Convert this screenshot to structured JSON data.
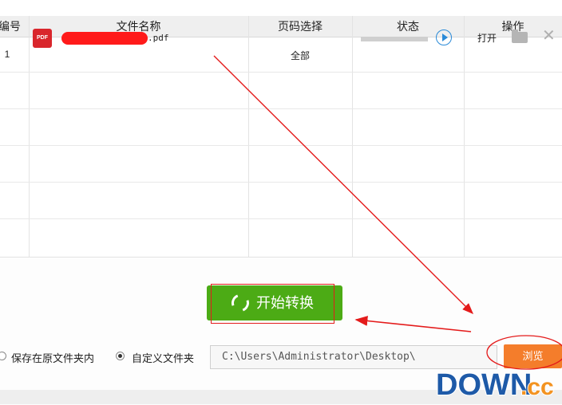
{
  "table": {
    "headers": [
      "编号",
      "文件名称",
      "页码选择",
      "状态",
      "操作"
    ],
    "rows": [
      {
        "index": "1",
        "file_icon_label": "PDF",
        "file_name_suffix": ".pdf",
        "page_selection": "全部",
        "progress": 0,
        "open_label": "打开"
      }
    ]
  },
  "icons": {
    "file": "pdf-file-icon",
    "play": "play-icon",
    "folder": "folder-icon",
    "close": "close-icon",
    "start": "refresh-icon"
  },
  "actions": {
    "start_label": "开始转换"
  },
  "output": {
    "option_original": "保存在原文件夹内",
    "option_custom": "自定义文件夹",
    "selected": "custom",
    "path": "C:\\Users\\Administrator\\Desktop\\",
    "browse_label": "浏览"
  },
  "watermark": {
    "text_main": "DOWN",
    "text_suffix": ".cc"
  },
  "colors": {
    "start_button": "#4cab15",
    "browse_button": "#f47d2b",
    "annotation_red": "#e41b1b",
    "pdf_icon": "#d9262c",
    "redaction": "#ff1a1a",
    "watermark_blue": "#1e5aa8",
    "watermark_orange": "#f39321"
  }
}
